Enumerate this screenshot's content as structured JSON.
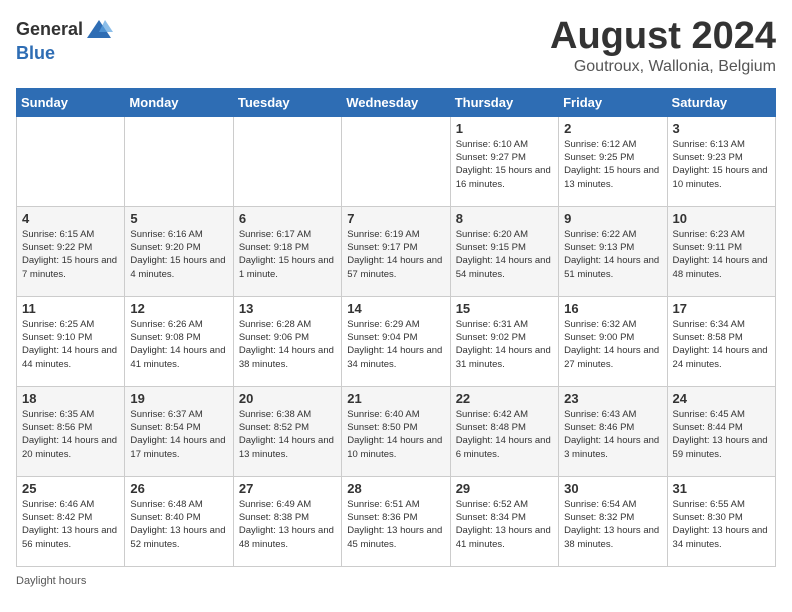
{
  "header": {
    "logo_general": "General",
    "logo_blue": "Blue",
    "month_year": "August 2024",
    "location": "Goutroux, Wallonia, Belgium"
  },
  "days_of_week": [
    "Sunday",
    "Monday",
    "Tuesday",
    "Wednesday",
    "Thursday",
    "Friday",
    "Saturday"
  ],
  "weeks": [
    [
      {
        "day": "",
        "info": ""
      },
      {
        "day": "",
        "info": ""
      },
      {
        "day": "",
        "info": ""
      },
      {
        "day": "",
        "info": ""
      },
      {
        "day": "1",
        "info": "Sunrise: 6:10 AM\nSunset: 9:27 PM\nDaylight: 15 hours and 16 minutes."
      },
      {
        "day": "2",
        "info": "Sunrise: 6:12 AM\nSunset: 9:25 PM\nDaylight: 15 hours and 13 minutes."
      },
      {
        "day": "3",
        "info": "Sunrise: 6:13 AM\nSunset: 9:23 PM\nDaylight: 15 hours and 10 minutes."
      }
    ],
    [
      {
        "day": "4",
        "info": "Sunrise: 6:15 AM\nSunset: 9:22 PM\nDaylight: 15 hours and 7 minutes."
      },
      {
        "day": "5",
        "info": "Sunrise: 6:16 AM\nSunset: 9:20 PM\nDaylight: 15 hours and 4 minutes."
      },
      {
        "day": "6",
        "info": "Sunrise: 6:17 AM\nSunset: 9:18 PM\nDaylight: 15 hours and 1 minute."
      },
      {
        "day": "7",
        "info": "Sunrise: 6:19 AM\nSunset: 9:17 PM\nDaylight: 14 hours and 57 minutes."
      },
      {
        "day": "8",
        "info": "Sunrise: 6:20 AM\nSunset: 9:15 PM\nDaylight: 14 hours and 54 minutes."
      },
      {
        "day": "9",
        "info": "Sunrise: 6:22 AM\nSunset: 9:13 PM\nDaylight: 14 hours and 51 minutes."
      },
      {
        "day": "10",
        "info": "Sunrise: 6:23 AM\nSunset: 9:11 PM\nDaylight: 14 hours and 48 minutes."
      }
    ],
    [
      {
        "day": "11",
        "info": "Sunrise: 6:25 AM\nSunset: 9:10 PM\nDaylight: 14 hours and 44 minutes."
      },
      {
        "day": "12",
        "info": "Sunrise: 6:26 AM\nSunset: 9:08 PM\nDaylight: 14 hours and 41 minutes."
      },
      {
        "day": "13",
        "info": "Sunrise: 6:28 AM\nSunset: 9:06 PM\nDaylight: 14 hours and 38 minutes."
      },
      {
        "day": "14",
        "info": "Sunrise: 6:29 AM\nSunset: 9:04 PM\nDaylight: 14 hours and 34 minutes."
      },
      {
        "day": "15",
        "info": "Sunrise: 6:31 AM\nSunset: 9:02 PM\nDaylight: 14 hours and 31 minutes."
      },
      {
        "day": "16",
        "info": "Sunrise: 6:32 AM\nSunset: 9:00 PM\nDaylight: 14 hours and 27 minutes."
      },
      {
        "day": "17",
        "info": "Sunrise: 6:34 AM\nSunset: 8:58 PM\nDaylight: 14 hours and 24 minutes."
      }
    ],
    [
      {
        "day": "18",
        "info": "Sunrise: 6:35 AM\nSunset: 8:56 PM\nDaylight: 14 hours and 20 minutes."
      },
      {
        "day": "19",
        "info": "Sunrise: 6:37 AM\nSunset: 8:54 PM\nDaylight: 14 hours and 17 minutes."
      },
      {
        "day": "20",
        "info": "Sunrise: 6:38 AM\nSunset: 8:52 PM\nDaylight: 14 hours and 13 minutes."
      },
      {
        "day": "21",
        "info": "Sunrise: 6:40 AM\nSunset: 8:50 PM\nDaylight: 14 hours and 10 minutes."
      },
      {
        "day": "22",
        "info": "Sunrise: 6:42 AM\nSunset: 8:48 PM\nDaylight: 14 hours and 6 minutes."
      },
      {
        "day": "23",
        "info": "Sunrise: 6:43 AM\nSunset: 8:46 PM\nDaylight: 14 hours and 3 minutes."
      },
      {
        "day": "24",
        "info": "Sunrise: 6:45 AM\nSunset: 8:44 PM\nDaylight: 13 hours and 59 minutes."
      }
    ],
    [
      {
        "day": "25",
        "info": "Sunrise: 6:46 AM\nSunset: 8:42 PM\nDaylight: 13 hours and 56 minutes."
      },
      {
        "day": "26",
        "info": "Sunrise: 6:48 AM\nSunset: 8:40 PM\nDaylight: 13 hours and 52 minutes."
      },
      {
        "day": "27",
        "info": "Sunrise: 6:49 AM\nSunset: 8:38 PM\nDaylight: 13 hours and 48 minutes."
      },
      {
        "day": "28",
        "info": "Sunrise: 6:51 AM\nSunset: 8:36 PM\nDaylight: 13 hours and 45 minutes."
      },
      {
        "day": "29",
        "info": "Sunrise: 6:52 AM\nSunset: 8:34 PM\nDaylight: 13 hours and 41 minutes."
      },
      {
        "day": "30",
        "info": "Sunrise: 6:54 AM\nSunset: 8:32 PM\nDaylight: 13 hours and 38 minutes."
      },
      {
        "day": "31",
        "info": "Sunrise: 6:55 AM\nSunset: 8:30 PM\nDaylight: 13 hours and 34 minutes."
      }
    ]
  ],
  "footer": {
    "note": "Daylight hours"
  }
}
